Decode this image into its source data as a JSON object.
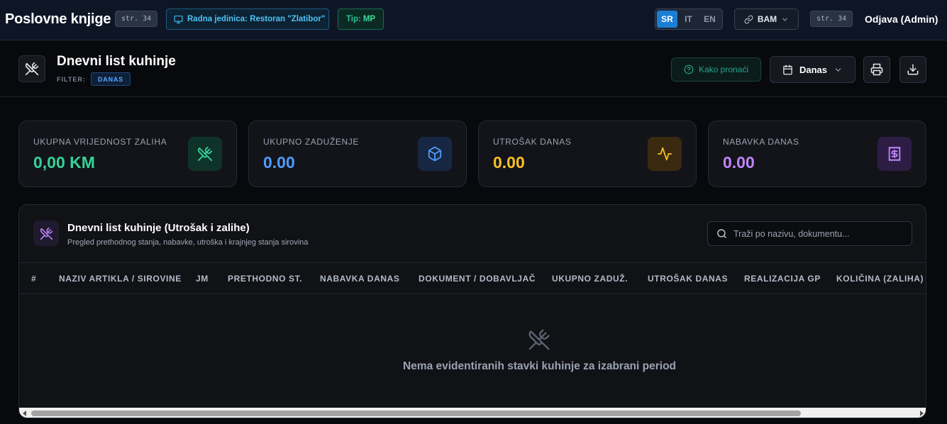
{
  "topbar": {
    "app_title": "Poslovne knjige",
    "page_badge": "str. 34",
    "unit_label": "Radna jedinica: Restoran \"Zlatibor\"",
    "tip_label": "Tip:",
    "tip_value": "MP",
    "languages": [
      "SR",
      "IT",
      "EN"
    ],
    "active_language": "SR",
    "currency": "BAM",
    "page_badge_right": "str. 34",
    "logout_label": "Odjava (Admin)"
  },
  "header": {
    "title": "Dnevni list kuhinje",
    "filter_label": "FILTER:",
    "filter_value": "DANAS",
    "howto_label": "Kako pronaći",
    "period_label": "Danas"
  },
  "stats": [
    {
      "label": "UKUPNA VRIJEDNOST ZALIHA",
      "value": "0,00 KM",
      "color": "#34d399",
      "icon": "utensils-crossed-icon"
    },
    {
      "label": "UKUPNO ZADUŽENJE",
      "value": "0.00",
      "color": "#4f9cf9",
      "icon": "box-icon"
    },
    {
      "label": "UTROŠAK DANAS",
      "value": "0.00",
      "color": "#fbbf24",
      "icon": "activity-icon"
    },
    {
      "label": "NABAVKA DANAS",
      "value": "0.00",
      "color": "#c084fc",
      "icon": "receipt-icon"
    }
  ],
  "table": {
    "title": "Dnevni list kuhinje (Utrošak i zalihe)",
    "subtitle": "Pregled prethodnog stanja, nabavke, utroška i krajnjeg stanja sirovina",
    "search_placeholder": "Traži po nazivu, dokumentu...",
    "columns": [
      "#",
      "NAZIV ARTIKLA / SIROVINE",
      "JM",
      "PRETHODNO ST.",
      "NABAVKA DANAS",
      "DOKUMENT / DOBAVLJAČ",
      "UKUPNO ZADUŽ.",
      "UTROŠAK DANAS",
      "REALIZACIJA GP",
      "KOLIČINA (ZALIHA)"
    ],
    "empty_message": "Nema evidentiranih stavki kuhinje za izabrani period"
  }
}
